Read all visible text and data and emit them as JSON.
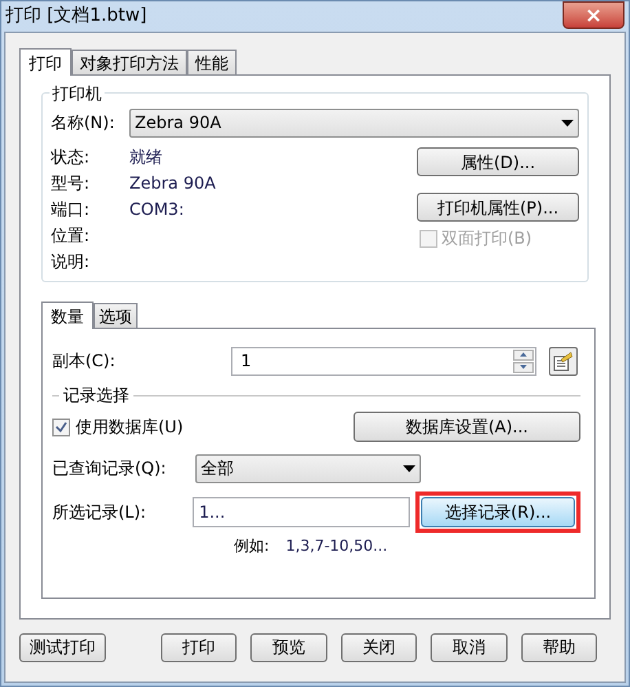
{
  "window": {
    "title": "打印 [文档1.btw]",
    "close": "×"
  },
  "tabs": [
    {
      "label": "打印",
      "selected": true
    },
    {
      "label": "对象打印方法",
      "selected": false
    },
    {
      "label": "性能",
      "selected": false
    }
  ],
  "printer": {
    "title": "打印机",
    "name_label": "名称(N):",
    "name_value": "Zebra 90A",
    "rows": [
      {
        "label": "状态:",
        "value": "就绪"
      },
      {
        "label": "型号:",
        "value": "Zebra 90A"
      },
      {
        "label": "端口:",
        "value": "COM3:"
      },
      {
        "label": "位置:"
      },
      {
        "label": "说明:"
      }
    ],
    "buttons": [
      "属性(D)...",
      "打印机属性(P)..."
    ],
    "duplex": {
      "label": "双面打印(B)",
      "checked": false,
      "disabled": true
    }
  },
  "sub_tabs": [
    {
      "label": "数量",
      "selected": true
    },
    {
      "label": "选项",
      "selected": false
    }
  ],
  "copies": {
    "label": "副本(C):",
    "value": "1"
  },
  "records": {
    "heading": "记录选择",
    "use_database": {
      "label": "使用数据库(U)",
      "checked": true
    },
    "database_button": "数据库设置(A)...",
    "queried": {
      "label": "已查询记录(Q):",
      "value": "全部"
    },
    "selected_records": {
      "label": "所选记录(L):",
      "value": "1..."
    },
    "select_button": {
      "label": "选择记录(R)...",
      "highlighted": true
    },
    "example": {
      "label": "例如:",
      "value": "1,3,7-10,50..."
    }
  },
  "buttons": [
    "测试打印",
    "打印",
    "预览",
    "关闭",
    "取消",
    "帮助"
  ]
}
